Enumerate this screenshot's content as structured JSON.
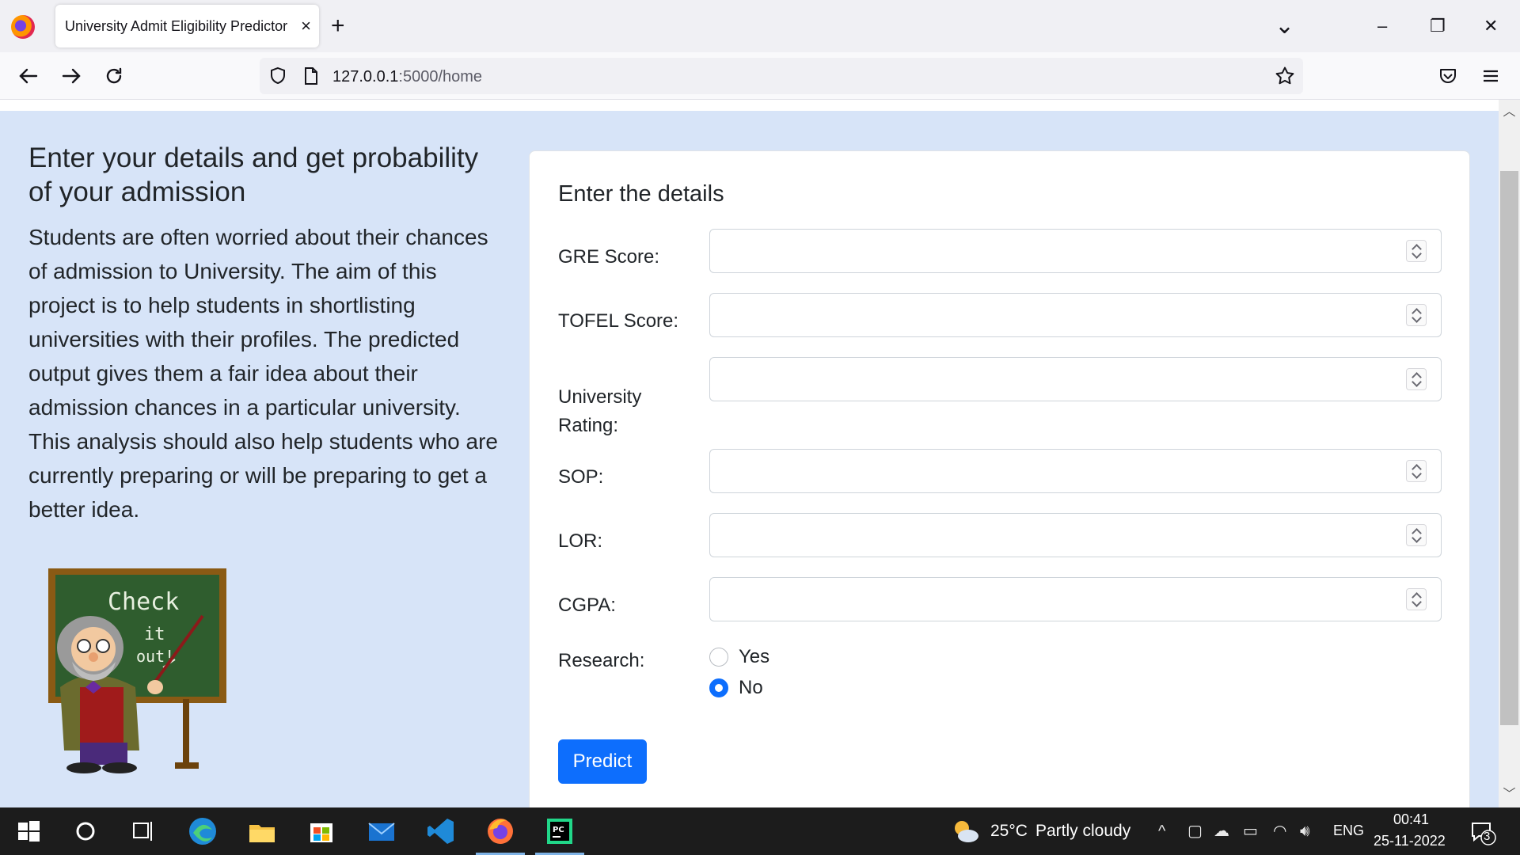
{
  "browser": {
    "tab_title": "University Admit Eligibility Predictor",
    "tab_close": "×",
    "new_tab": "+",
    "url_host": "127.0.0.1",
    "url_rest": ":5000/home",
    "win_minimize": "–",
    "win_restore": "❐",
    "win_close": "✕",
    "tab_list": "⌄"
  },
  "intro": {
    "heading": "Enter your details and get probability of your admission",
    "description": "Students are often worried about their chances of admission to University. The aim of this project is to help students in shortlisting universities with their profiles. The predicted output gives them a fair idea about their admission chances in a particular university. This analysis should also help students who are currently preparing or will be preparing to get a better idea.",
    "image_text": [
      "Check",
      "it",
      "out!"
    ]
  },
  "form": {
    "title": "Enter the details",
    "fields": [
      {
        "label": "GRE Score:",
        "value": ""
      },
      {
        "label": "TOFEL Score:",
        "value": ""
      },
      {
        "label": "University Rating:",
        "value": ""
      },
      {
        "label": "SOP:",
        "value": ""
      },
      {
        "label": "LOR:",
        "value": ""
      },
      {
        "label": "CGPA:",
        "value": ""
      }
    ],
    "research": {
      "label": "Research:",
      "options": [
        {
          "label": "Yes",
          "checked": false
        },
        {
          "label": "No",
          "checked": true
        }
      ]
    },
    "submit_label": "Predict"
  },
  "taskbar": {
    "weather_temp": "25°C",
    "weather_desc": "Partly cloudy",
    "language": "ENG",
    "time": "00:41",
    "date": "25-11-2022",
    "notification_count": "3"
  },
  "colors": {
    "page_bg": "#d7e4f8",
    "primary": "#0d6efd",
    "taskbar_bg": "#1c1c1c"
  }
}
